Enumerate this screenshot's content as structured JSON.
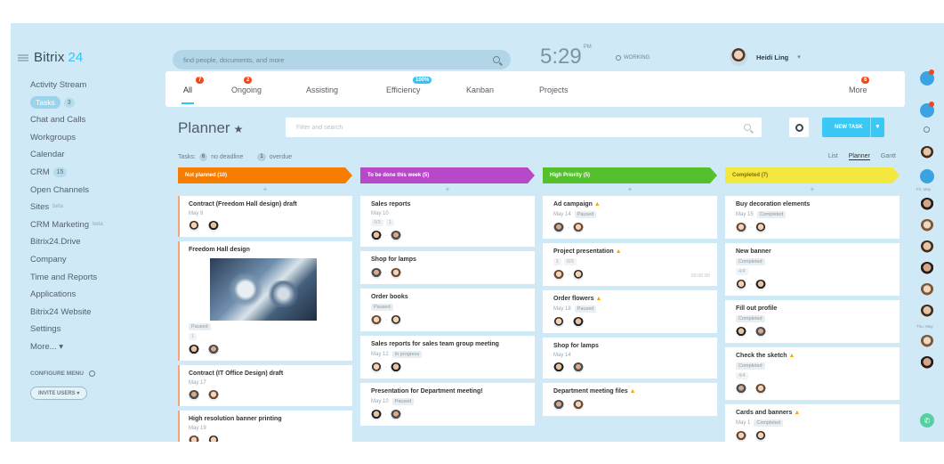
{
  "app": {
    "logo_main": "Bitrix",
    "logo_num": "24"
  },
  "sidebar": {
    "items": [
      {
        "label": "Activity Stream"
      },
      {
        "label": "Tasks",
        "count": "3",
        "active": true
      },
      {
        "label": "Chat and Calls"
      },
      {
        "label": "Workgroups"
      },
      {
        "label": "Calendar"
      },
      {
        "label": "CRM",
        "count": "15"
      },
      {
        "label": "Open Channels"
      },
      {
        "label": "Sites",
        "sup": "beta"
      },
      {
        "label": "CRM Marketing",
        "sup": "beta"
      },
      {
        "label": "Bitrix24.Drive"
      },
      {
        "label": "Company"
      },
      {
        "label": "Time and Reports"
      },
      {
        "label": "Applications"
      },
      {
        "label": "Bitrix24 Website"
      },
      {
        "label": "Settings"
      },
      {
        "label": "More... ▾"
      }
    ],
    "configure": "CONFIGURE MENU",
    "invite": "INVITE USERS ▾"
  },
  "header": {
    "search_placeholder": "find people, documents, and more",
    "time": "5:29",
    "time_suffix": "PM",
    "working": "WORKING",
    "user_name": "Heidi Ling",
    "user_chevron": "▾"
  },
  "tabs": [
    {
      "label": "All",
      "badge": "7",
      "active": true
    },
    {
      "label": "Ongoing",
      "badge": "2"
    },
    {
      "label": "Assisting"
    },
    {
      "label": "Efficiency",
      "badge": "100%",
      "badge_color": "blue"
    },
    {
      "label": "Kanban"
    },
    {
      "label": "Projects"
    }
  ],
  "more_tab": {
    "label": "More",
    "badge": "6"
  },
  "planner": {
    "title": "Planner",
    "star": "★",
    "filter_placeholder": "Filter and search",
    "new_task": "NEW TASK",
    "new_task_arrow": "▾"
  },
  "counters": {
    "tasks_label": "Tasks:",
    "no_deadline_count": "6",
    "no_deadline_label": "no deadline",
    "overdue_count": "1",
    "overdue_label": "overdue"
  },
  "views": [
    "List",
    "Planner",
    "Gantt"
  ],
  "columns": [
    {
      "title": "Not planned",
      "count": "(10)",
      "color": "#f77d00",
      "cards": [
        {
          "title": "Contract (Freedom Hall design) draft",
          "date": "May 9"
        },
        {
          "title": "Freedom Hall design",
          "image": true,
          "pill": "Paused",
          "meta": [
            "1"
          ]
        },
        {
          "title": "Contract (IT Office Design) draft",
          "date": "May 17"
        },
        {
          "title": "High resolution banner printing",
          "date": "May 19"
        }
      ]
    },
    {
      "title": "To be done this week",
      "count": "(5)",
      "color": "#b748c8",
      "cards": [
        {
          "title": "Sales reports",
          "date": "May 10",
          "meta": [
            "0/3",
            "1"
          ]
        },
        {
          "title": "Shop for lamps"
        },
        {
          "title": "Order books",
          "pill": "Paused"
        },
        {
          "title": "Sales reports for sales team group meeting",
          "date": "May 12",
          "pill": "In progress"
        },
        {
          "title": "Presentation for Department meeting!",
          "date": "May 10",
          "pill": "Paused"
        }
      ]
    },
    {
      "title": "High Priority",
      "count": "(5)",
      "color": "#55c02e",
      "cards": [
        {
          "title": "Ad campaign",
          "fire": "▲",
          "date": "May 14",
          "pill": "Paused"
        },
        {
          "title": "Project presentation",
          "fire": "▲",
          "meta": [
            "1",
            "0/3"
          ],
          "time": "00:00:00"
        },
        {
          "title": "Order flowers",
          "fire": "▲",
          "date": "May 18",
          "pill": "Paused"
        },
        {
          "title": "Shop for lamps",
          "date": "May 14"
        },
        {
          "title": "Department meeting files",
          "fire": "▲"
        }
      ]
    },
    {
      "title": "Completed",
      "count": "(7)",
      "color": "#f4e73d",
      "cards": [
        {
          "title": "Buy decoration elements",
          "date": "May 15",
          "pill": "Completed"
        },
        {
          "title": "New banner",
          "pill": "Completed",
          "meta": [
            "4/4"
          ]
        },
        {
          "title": "Fill out profile",
          "pill": "Completed"
        },
        {
          "title": "Check the sketch",
          "fire": "▲",
          "pill": "Completed",
          "meta": [
            "4/4"
          ]
        },
        {
          "title": "Cards and banners",
          "fire": "▲",
          "date": "May 1",
          "pill": "Completed"
        }
      ]
    }
  ],
  "right_strip": {
    "fri_label": "Fri, May",
    "thu_label": "Thu, May",
    "phone": "✆"
  },
  "icons": {
    "search": "search-icon",
    "gear": "gear-icon",
    "star": "star-icon",
    "phone": "phone-icon",
    "burger": "menu-icon"
  },
  "colors": {
    "accent": "#2fc6f6",
    "badge": "#f54819",
    "background": "#cfe9f6"
  }
}
